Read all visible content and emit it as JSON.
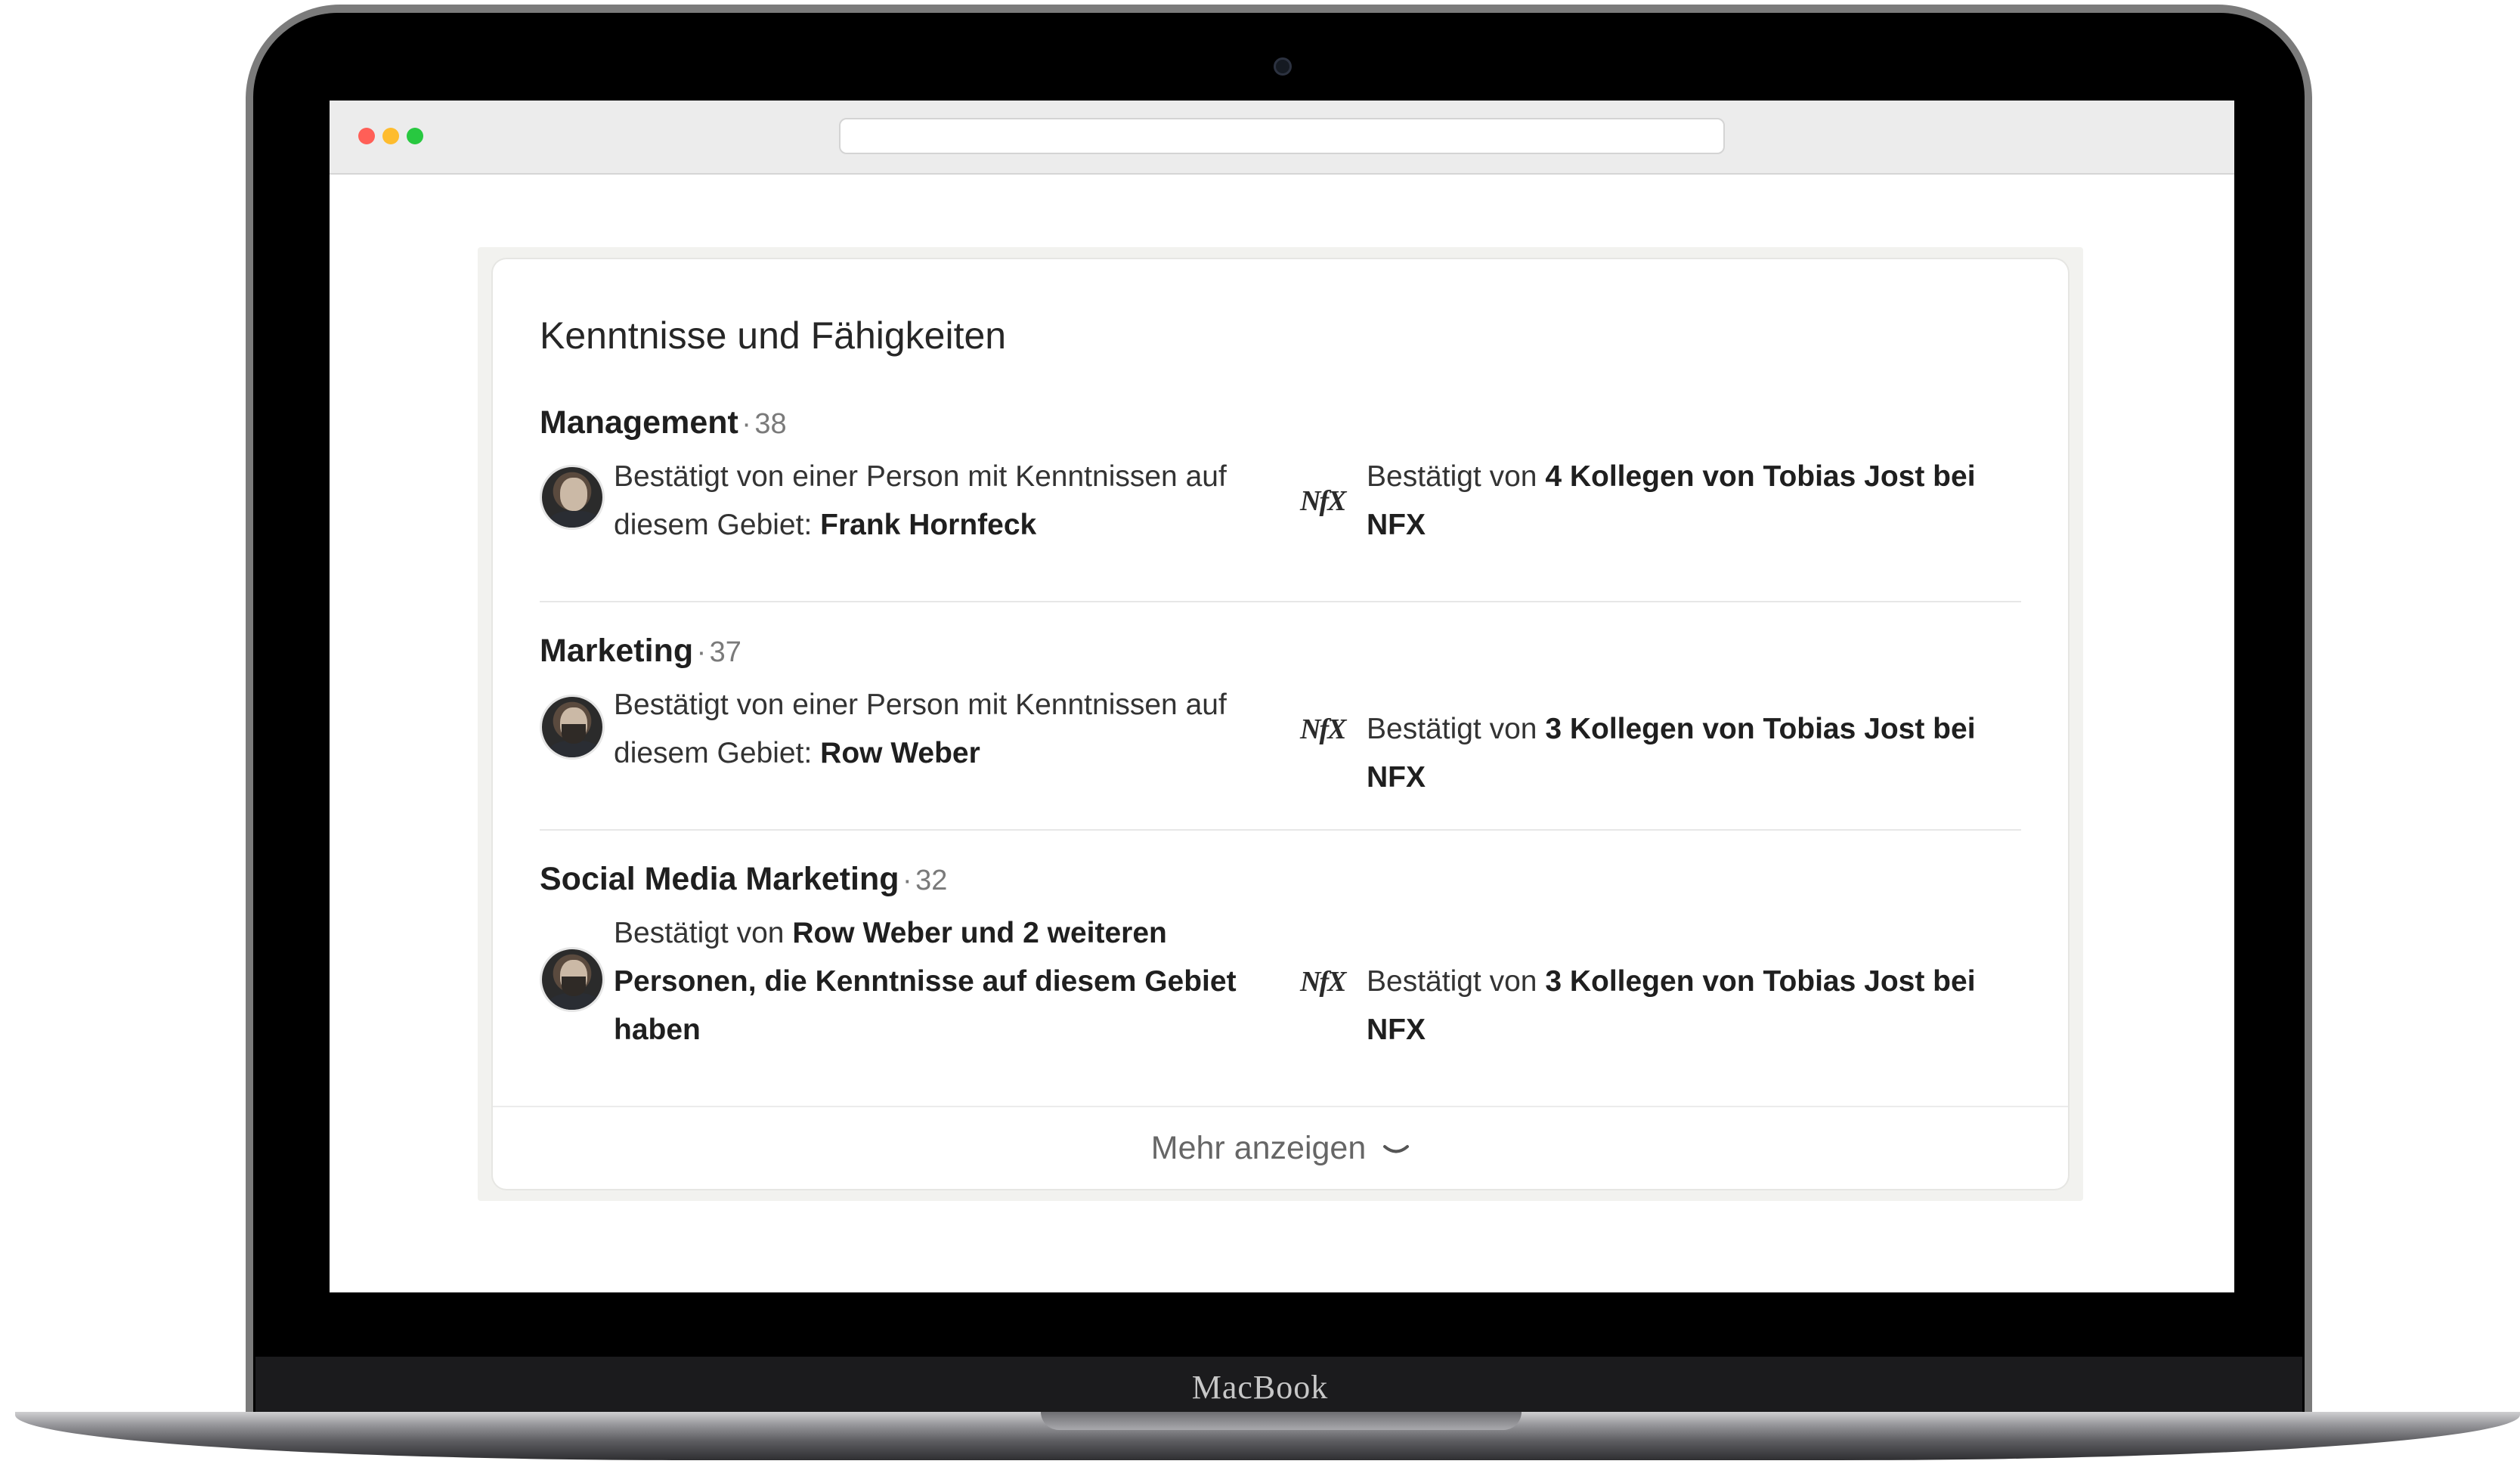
{
  "device": {
    "brand_label": "MacBook"
  },
  "section": {
    "title": "Kenntnisse und Fähigkeiten",
    "skills": [
      {
        "name": "Management",
        "separator": "·",
        "count": "38",
        "left_prefix": "Bestätigt von einer Person mit Kenntnissen auf diesem Gebiet:",
        "left_bold": "Frank Hornfeck",
        "right_prefix": "Bestätigt von",
        "right_bold": "4 Kollegen von Tobias Jost bei NFX"
      },
      {
        "name": "Marketing",
        "separator": "·",
        "count": "37",
        "left_prefix": "Bestätigt von einer Person mit Kenntnissen auf diesem Gebiet:",
        "left_bold": "Row Weber",
        "right_prefix": "Bestätigt von",
        "right_bold": "3 Kollegen von Tobias Jost bei NFX"
      },
      {
        "name": "Social Media Marketing",
        "separator": "·",
        "count": "32",
        "left_prefix": "Bestätigt von",
        "left_bold": "Row Weber und 2 weiteren Personen, die Kenntnisse auf diesem Gebiet haben",
        "right_prefix": "Bestätigt von",
        "right_bold": "3 Kollegen von Tobias Jost bei NFX"
      }
    ],
    "company_logo_text": "NfX",
    "show_more_label": "Mehr anzeigen"
  },
  "icons": {
    "show_more": "chevron-down-icon",
    "company": "nfx-logo-icon"
  }
}
